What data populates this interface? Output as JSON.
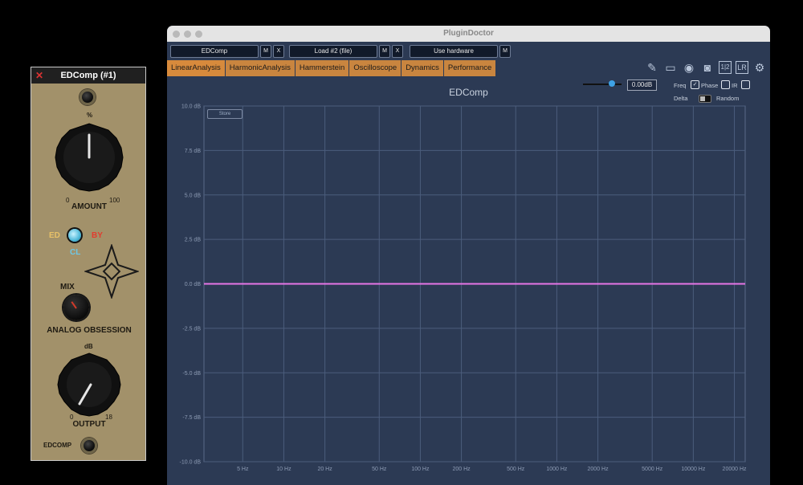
{
  "edcomp": {
    "title": "EDComp (#1)",
    "close_glyph": "✕",
    "amount": {
      "unit": "%",
      "min": "0",
      "max": "100",
      "label": "AMOUNT"
    },
    "mode": {
      "left": "ED",
      "right": "BY",
      "bottom": "CL"
    },
    "mix_label": "MIX",
    "brand": "ANALOG OBSESSION",
    "output": {
      "unit": "dB",
      "min": "0",
      "max": "18",
      "label": "OUTPUT"
    },
    "footer": "EDCOMP"
  },
  "plugindoctor": {
    "title": "PluginDoctor",
    "toolbar": {
      "slot1": "EDComp",
      "slot1_m": "M",
      "slot1_x": "X",
      "slot2": "Load #2 (file)",
      "slot2_m": "M",
      "slot2_x": "X",
      "slot3": "Use hardware",
      "slot3_m": "M"
    },
    "tabs": [
      "LinearAnalysis",
      "HarmonicAnalysis",
      "Hammerstein",
      "Oscilloscope",
      "Dynamics",
      "Performance"
    ],
    "active_tab": "LinearAnalysis",
    "plot_title": "EDComp",
    "gain_value": "0.00dB",
    "options": {
      "freq": "Freq",
      "phase": "Phase",
      "ir": "IR",
      "delta": "Delta",
      "random": "Random"
    },
    "store_button": "Store",
    "icons": [
      "notes-icon",
      "book-icon",
      "eye-icon",
      "camera-icon",
      "1-2-icon",
      "lr-icon",
      "gear-icon"
    ],
    "icon_text": {
      "onetwo": "1|2",
      "lr": "LR"
    }
  },
  "chart_data": {
    "type": "line",
    "y_ticks": [
      "10.0 dB",
      "7.5 dB",
      "5.0 dB",
      "2.5 dB",
      "0.0 dB",
      "-2.5 dB",
      "-5.0 dB",
      "-7.5 dB",
      "-10.0 dB"
    ],
    "ylim": [
      -10,
      10
    ],
    "x_ticks": [
      "5 Hz",
      "10 Hz",
      "20 Hz",
      "50 Hz",
      "100 Hz",
      "200 Hz",
      "500 Hz",
      "1000 Hz",
      "2000 Hz",
      "5000 Hz",
      "10000 Hz",
      "20000 Hz"
    ],
    "x_tick_values": [
      5,
      10,
      20,
      50,
      100,
      200,
      500,
      1000,
      2000,
      5000,
      10000,
      20000
    ],
    "xlim": [
      2.6,
      24000
    ],
    "xscale": "log",
    "series": [
      {
        "x": [
          2.6,
          24000
        ],
        "y": [
          0,
          0
        ],
        "color": "#e675e6"
      }
    ]
  }
}
